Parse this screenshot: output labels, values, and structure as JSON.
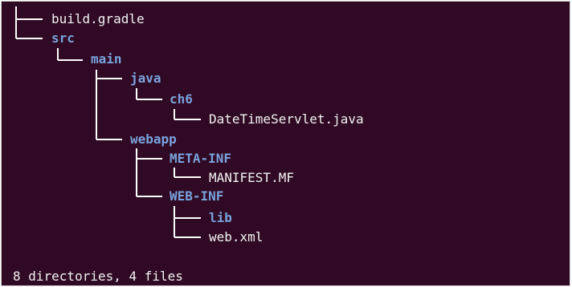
{
  "tree": {
    "entries": [
      {
        "name": "build.gradle",
        "type": "file"
      },
      {
        "name": "src",
        "type": "dir"
      },
      {
        "name": "main",
        "type": "dir"
      },
      {
        "name": "java",
        "type": "dir"
      },
      {
        "name": "ch6",
        "type": "dir"
      },
      {
        "name": "DateTimeServlet.java",
        "type": "file"
      },
      {
        "name": "webapp",
        "type": "dir"
      },
      {
        "name": "META-INF",
        "type": "dir"
      },
      {
        "name": "MANIFEST.MF",
        "type": "file"
      },
      {
        "name": "WEB-INF",
        "type": "dir"
      },
      {
        "name": "lib",
        "type": "dir"
      },
      {
        "name": "web.xml",
        "type": "file"
      }
    ]
  },
  "summary": "8 directories, 4 files",
  "colors": {
    "background": "#300a24",
    "directory": "#7aa2dc",
    "file": "#f2f2f2",
    "connector": "#ffffff"
  }
}
